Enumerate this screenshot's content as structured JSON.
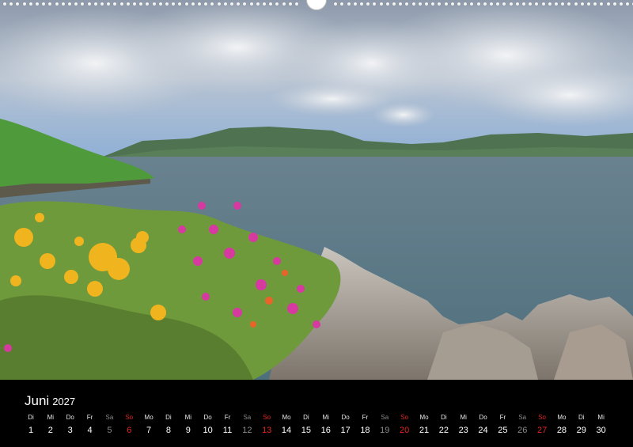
{
  "calendar": {
    "month": "Juni",
    "year": "2027",
    "days": [
      {
        "wd": "Di",
        "d": "1",
        "type": "weekday"
      },
      {
        "wd": "Mi",
        "d": "2",
        "type": "weekday"
      },
      {
        "wd": "Do",
        "d": "3",
        "type": "weekday"
      },
      {
        "wd": "Fr",
        "d": "4",
        "type": "weekday"
      },
      {
        "wd": "Sa",
        "d": "5",
        "type": "sat"
      },
      {
        "wd": "So",
        "d": "6",
        "type": "sun"
      },
      {
        "wd": "Mo",
        "d": "7",
        "type": "weekday"
      },
      {
        "wd": "Di",
        "d": "8",
        "type": "weekday"
      },
      {
        "wd": "Mi",
        "d": "9",
        "type": "weekday"
      },
      {
        "wd": "Do",
        "d": "10",
        "type": "weekday"
      },
      {
        "wd": "Fr",
        "d": "11",
        "type": "weekday"
      },
      {
        "wd": "Sa",
        "d": "12",
        "type": "sat"
      },
      {
        "wd": "So",
        "d": "13",
        "type": "sun"
      },
      {
        "wd": "Mo",
        "d": "14",
        "type": "weekday"
      },
      {
        "wd": "Di",
        "d": "15",
        "type": "weekday"
      },
      {
        "wd": "Mi",
        "d": "16",
        "type": "weekday"
      },
      {
        "wd": "Do",
        "d": "17",
        "type": "weekday"
      },
      {
        "wd": "Fr",
        "d": "18",
        "type": "weekday"
      },
      {
        "wd": "Sa",
        "d": "19",
        "type": "sat"
      },
      {
        "wd": "So",
        "d": "20",
        "type": "sun"
      },
      {
        "wd": "Mo",
        "d": "21",
        "type": "weekday"
      },
      {
        "wd": "Di",
        "d": "22",
        "type": "weekday"
      },
      {
        "wd": "Mi",
        "d": "23",
        "type": "weekday"
      },
      {
        "wd": "Do",
        "d": "24",
        "type": "weekday"
      },
      {
        "wd": "Fr",
        "d": "25",
        "type": "weekday"
      },
      {
        "wd": "Sa",
        "d": "26",
        "type": "sat"
      },
      {
        "wd": "So",
        "d": "27",
        "type": "sun"
      },
      {
        "wd": "Mo",
        "d": "28",
        "type": "weekday"
      },
      {
        "wd": "Di",
        "d": "29",
        "type": "weekday"
      },
      {
        "wd": "Mi",
        "d": "30",
        "type": "weekday"
      }
    ]
  },
  "colors": {
    "sunday": "#e2251f",
    "saturday": "#8a8a8a",
    "weekday": "#ffffff",
    "bar": "#000000"
  }
}
